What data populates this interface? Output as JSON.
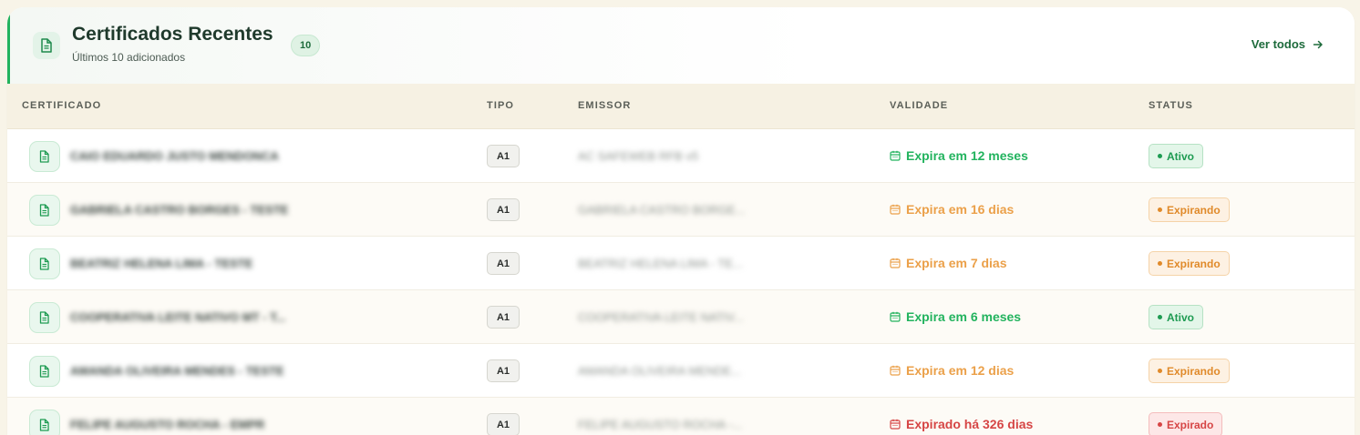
{
  "header": {
    "title": "Certificados Recentes",
    "subtitle": "Últimos 10 adicionados",
    "count": "10",
    "see_all_label": "Ver todos"
  },
  "table": {
    "columns": [
      "CERTIFICADO",
      "TIPO",
      "EMISSOR",
      "VALIDADE",
      "STATUS"
    ],
    "rows": [
      {
        "name": "CAIO EDUARDO JUSTO MENDONCA",
        "type": "A1",
        "issuer": "AC SAFEWEB RFB v5",
        "validity": "Expira em 12 meses",
        "validity_tone": "green",
        "status": "Ativo",
        "status_tone": "active"
      },
      {
        "name": "GABRIELA CASTRO BORGES - TESTE",
        "type": "A1",
        "issuer": "GABRIELA CASTRO BORGE...",
        "validity": "Expira em 16 dias",
        "validity_tone": "orange",
        "status": "Expirando",
        "status_tone": "expiring"
      },
      {
        "name": "BEATRIZ HELENA LIMA - TESTE",
        "type": "A1",
        "issuer": "BEATRIZ HELENA LIMA - TE...",
        "validity": "Expira em 7 dias",
        "validity_tone": "orange",
        "status": "Expirando",
        "status_tone": "expiring"
      },
      {
        "name": "COOPERATIVA LEITE NATIVO MT - T...",
        "type": "A1",
        "issuer": "COOPERATIVA LEITE NATIV...",
        "validity": "Expira em 6 meses",
        "validity_tone": "green",
        "status": "Ativo",
        "status_tone": "active"
      },
      {
        "name": "AMANDA OLIVEIRA MENDES - TESTE",
        "type": "A1",
        "issuer": "AMANDA OLIVEIRA MENDE...",
        "validity": "Expira em 12 dias",
        "validity_tone": "orange",
        "status": "Expirando",
        "status_tone": "expiring"
      },
      {
        "name": "FELIPE AUGUSTO ROCHA - EMPR",
        "type": "A1",
        "issuer": "FELIPE AUGUSTO ROCHA -...",
        "validity": "Expirado há 326 dias",
        "validity_tone": "red",
        "status": "Expirado",
        "status_tone": "expired"
      }
    ]
  },
  "colors": {
    "accent": "#22b35e",
    "warning": "#eba049",
    "danger": "#d64545",
    "header_bg": "#f6f1e3"
  },
  "icons": {
    "header": "document-icon",
    "row": "file-icon",
    "validity": "calendar-icon",
    "see_all": "arrow-right-icon"
  }
}
